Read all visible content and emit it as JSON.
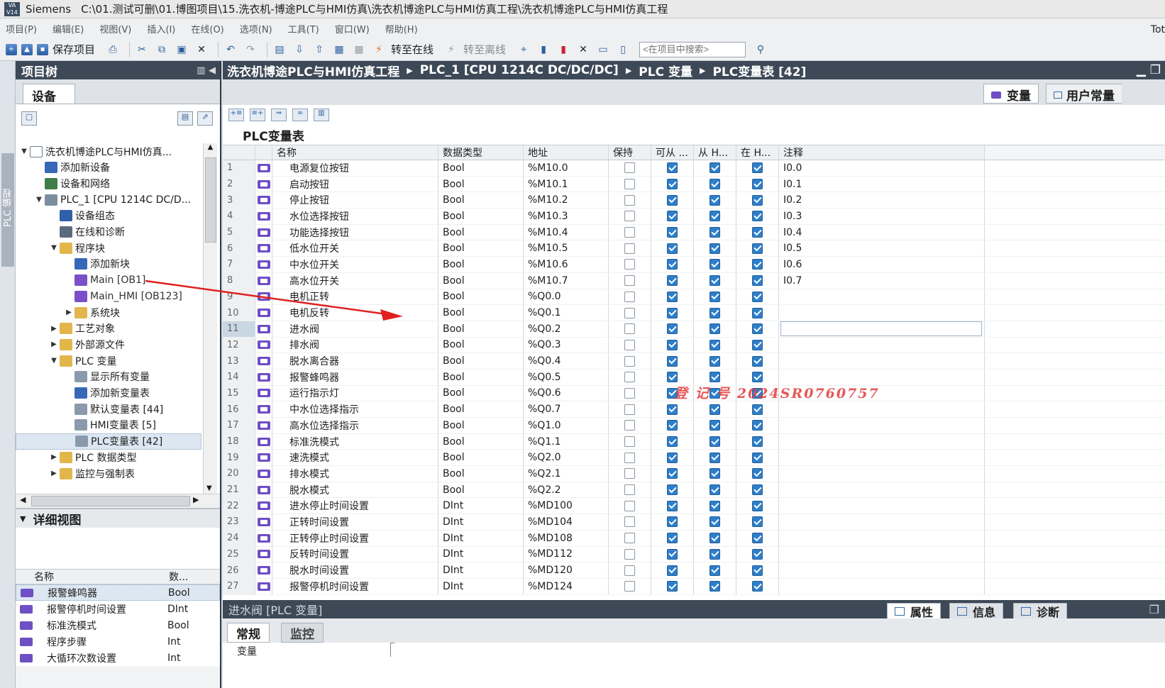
{
  "titlebar": {
    "app": "Siemens",
    "path": "C:\\01.测试可删\\01.博图项目\\15.洗衣机-博途PLC与HMI仿真\\洗衣机博途PLC与HMI仿真工程\\洗衣机博途PLC与HMI仿真工程"
  },
  "menu": [
    "项目(P)",
    "编辑(E)",
    "视图(V)",
    "插入(I)",
    "在线(O)",
    "选项(N)",
    "工具(T)",
    "窗口(W)",
    "帮助(H)"
  ],
  "menu_right": "Tot",
  "toolbar": {
    "save": "保存项目",
    "go_online": "转至在线",
    "go_offline": "转至离线",
    "search_placeholder": "<在项目中搜索>"
  },
  "leftstrip_label": "PLC 编程",
  "project_tree": {
    "title": "项目树",
    "devices_tab": "设备",
    "nodes": [
      {
        "label": "洗衣机博途PLC与HMI仿真...",
        "icon": "proj",
        "arrow": "▼"
      },
      {
        "label": "添加新设备",
        "icon": "add",
        "arrow": ""
      },
      {
        "label": "设备和网络",
        "icon": "net",
        "arrow": ""
      },
      {
        "label": "PLC_1 [CPU 1214C DC/D...",
        "icon": "plc",
        "arrow": "▼"
      },
      {
        "label": "设备组态",
        "icon": "cfg",
        "arrow": ""
      },
      {
        "label": "在线和诊断",
        "icon": "diag",
        "arrow": ""
      },
      {
        "label": "程序块",
        "icon": "fld",
        "arrow": "▼"
      },
      {
        "label": "添加新块",
        "icon": "add",
        "arrow": ""
      },
      {
        "label": "Main [OB1]",
        "icon": "blk",
        "arrow": ""
      },
      {
        "label": "Main_HMI [OB123]",
        "icon": "blk",
        "arrow": ""
      },
      {
        "label": "系统块",
        "icon": "fld",
        "arrow": "▶"
      },
      {
        "label": "工艺对象",
        "icon": "fld",
        "arrow": "▶"
      },
      {
        "label": "外部源文件",
        "icon": "fld",
        "arrow": "▶"
      },
      {
        "label": "PLC 变量",
        "icon": "fld",
        "arrow": "▼"
      },
      {
        "label": "显示所有变量",
        "icon": "tbl",
        "arrow": ""
      },
      {
        "label": "添加新变量表",
        "icon": "add",
        "arrow": ""
      },
      {
        "label": "默认变量表 [44]",
        "icon": "tbl",
        "arrow": ""
      },
      {
        "label": "HMI变量表 [5]",
        "icon": "tbl",
        "arrow": ""
      },
      {
        "label": "PLC变量表 [42]",
        "icon": "tbl",
        "arrow": ""
      },
      {
        "label": "PLC 数据类型",
        "icon": "fld",
        "arrow": "▶"
      },
      {
        "label": "监控与强制表",
        "icon": "fld",
        "arrow": "▶"
      }
    ]
  },
  "detail_view": {
    "title": "详细视图",
    "col_name": "名称",
    "col_type": "数...",
    "rows": [
      {
        "name": "报警蜂鸣器",
        "type": "Bool"
      },
      {
        "name": "报警停机时间设置",
        "type": "DInt"
      },
      {
        "name": "标准洗模式",
        "type": "Bool"
      },
      {
        "name": "程序步骤",
        "type": "Int"
      },
      {
        "name": "大循环次数设置",
        "type": "Int"
      }
    ]
  },
  "breadcrumb": [
    "洗衣机博途PLC与HMI仿真工程",
    "PLC_1 [CPU 1214C DC/DC/DC]",
    "PLC 变量",
    "PLC变量表 [42]"
  ],
  "editor_tabs": {
    "tags": "变量",
    "user_constants": "用户常量"
  },
  "table_title": "PLC变量表",
  "columns": {
    "name": "名称",
    "type": "数据类型",
    "address": "地址",
    "retain": "保持",
    "access": "可从 ...",
    "from_hmi": "从 H...",
    "in_hmi": "在 H...",
    "comment": "注释"
  },
  "rows": [
    {
      "n": "1",
      "name": "电源复位按钮",
      "type": "Bool",
      "addr": "%M10.0",
      "comment": "I0.0"
    },
    {
      "n": "2",
      "name": "启动按钮",
      "type": "Bool",
      "addr": "%M10.1",
      "comment": "I0.1"
    },
    {
      "n": "3",
      "name": "停止按钮",
      "type": "Bool",
      "addr": "%M10.2",
      "comment": "I0.2"
    },
    {
      "n": "4",
      "name": "水位选择按钮",
      "type": "Bool",
      "addr": "%M10.3",
      "comment": "I0.3"
    },
    {
      "n": "5",
      "name": "功能选择按钮",
      "type": "Bool",
      "addr": "%M10.4",
      "comment": "I0.4"
    },
    {
      "n": "6",
      "name": "低水位开关",
      "type": "Bool",
      "addr": "%M10.5",
      "comment": "I0.5"
    },
    {
      "n": "7",
      "name": "中水位开关",
      "type": "Bool",
      "addr": "%M10.6",
      "comment": "I0.6"
    },
    {
      "n": "8",
      "name": "高水位开关",
      "type": "Bool",
      "addr": "%M10.7",
      "comment": "I0.7"
    },
    {
      "n": "9",
      "name": "电机正转",
      "type": "Bool",
      "addr": "%Q0.0",
      "comment": ""
    },
    {
      "n": "10",
      "name": "电机反转",
      "type": "Bool",
      "addr": "%Q0.1",
      "comment": ""
    },
    {
      "n": "11",
      "name": "进水阀",
      "type": "Bool",
      "addr": "%Q0.2",
      "comment": ""
    },
    {
      "n": "12",
      "name": "排水阀",
      "type": "Bool",
      "addr": "%Q0.3",
      "comment": ""
    },
    {
      "n": "13",
      "name": "脱水离合器",
      "type": "Bool",
      "addr": "%Q0.4",
      "comment": ""
    },
    {
      "n": "14",
      "name": "报警蜂鸣器",
      "type": "Bool",
      "addr": "%Q0.5",
      "comment": ""
    },
    {
      "n": "15",
      "name": "运行指示灯",
      "type": "Bool",
      "addr": "%Q0.6",
      "comment": ""
    },
    {
      "n": "16",
      "name": "中水位选择指示",
      "type": "Bool",
      "addr": "%Q0.7",
      "comment": ""
    },
    {
      "n": "17",
      "name": "高水位选择指示",
      "type": "Bool",
      "addr": "%Q1.0",
      "comment": ""
    },
    {
      "n": "18",
      "name": "标准洗模式",
      "type": "Bool",
      "addr": "%Q1.1",
      "comment": ""
    },
    {
      "n": "19",
      "name": "速洗模式",
      "type": "Bool",
      "addr": "%Q2.0",
      "comment": ""
    },
    {
      "n": "20",
      "name": "排水模式",
      "type": "Bool",
      "addr": "%Q2.1",
      "comment": ""
    },
    {
      "n": "21",
      "name": "脱水模式",
      "type": "Bool",
      "addr": "%Q2.2",
      "comment": ""
    },
    {
      "n": "22",
      "name": "进水停止时间设置",
      "type": "DInt",
      "addr": "%MD100",
      "comment": ""
    },
    {
      "n": "23",
      "name": "正转时间设置",
      "type": "DInt",
      "addr": "%MD104",
      "comment": ""
    },
    {
      "n": "24",
      "name": "正转停止时间设置",
      "type": "DInt",
      "addr": "%MD108",
      "comment": ""
    },
    {
      "n": "25",
      "name": "反转时间设置",
      "type": "DInt",
      "addr": "%MD112",
      "comment": ""
    },
    {
      "n": "26",
      "name": "脱水时间设置",
      "type": "DInt",
      "addr": "%MD120",
      "comment": ""
    },
    {
      "n": "27",
      "name": "报警停机时间设置",
      "type": "DInt",
      "addr": "%MD124",
      "comment": ""
    }
  ],
  "watermark": "登 记 号 2024SR0760757",
  "properties": {
    "title": "进水阀 [PLC 变量]",
    "tab_props": "属性",
    "tab_info": "信息",
    "tab_diag": "诊断",
    "sub_general": "常规",
    "sub_monitor": "监控",
    "section": "变量"
  }
}
